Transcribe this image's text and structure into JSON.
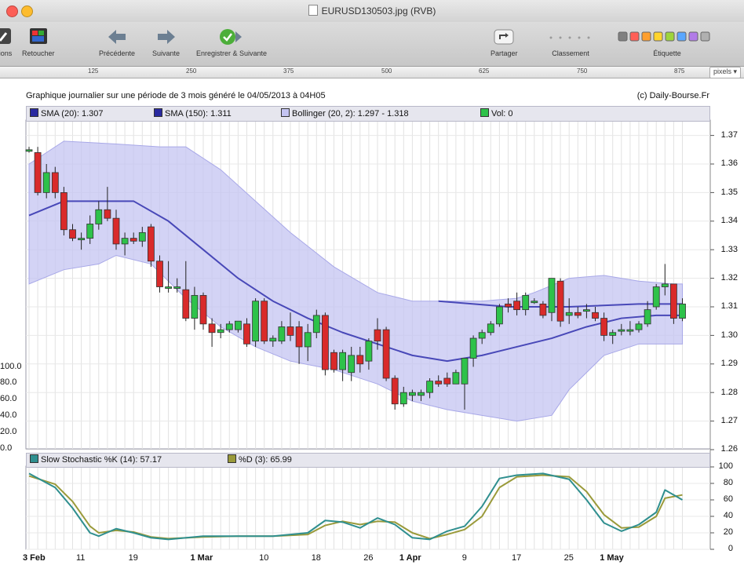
{
  "window": {
    "title": "EURUSD130503.jpg (RVB)",
    "colors": {
      "close": "#fc5f57",
      "minimize": "#fdbc2e",
      "zoom": "#28c840"
    }
  },
  "toolbar": {
    "items": [
      {
        "label": "ions",
        "icon": "adjust-icon"
      },
      {
        "label": "Retoucher",
        "icon": "retouch-icon"
      },
      {
        "label": "Précédente",
        "icon": "arrow-left-icon"
      },
      {
        "label": "Suivante",
        "icon": "arrow-right-icon"
      },
      {
        "label": "Enregistrer & Suivante",
        "icon": "save-next-icon"
      },
      {
        "label": "Partager",
        "icon": "share-icon"
      },
      {
        "label": "Classement",
        "icon": "rating-icon"
      },
      {
        "label": "Étiquette",
        "icon": "label-color-icon"
      }
    ],
    "label_colors": [
      "#808080",
      "#ff5f57",
      "#ff9f2e",
      "#ffd42e",
      "#9ed53b",
      "#5aa7ff",
      "#b27be8",
      "#b0b0b0"
    ]
  },
  "ruler": {
    "ticks": [
      "125",
      "250",
      "375",
      "500",
      "625",
      "750",
      "875"
    ],
    "unit": "pixels"
  },
  "chart": {
    "title": "Graphique journalier sur une période de 3 mois généré le 04/05/2013 à 04H05",
    "copyright": "(c) Daily-Bourse.Fr",
    "legend": {
      "sma20": "SMA (20): 1.307",
      "sma150": "SMA (150): 1.311",
      "bollinger": "Bollinger (20, 2): 1.297 - 1.318",
      "vol": "Vol: 0"
    },
    "stoch_legend": {
      "k": "Slow Stochastic %K (14): 57.17",
      "d": "%D (3): 65.99"
    },
    "colors": {
      "up": "#2ec24a",
      "down": "#d92a2a",
      "band": "#c4c4f2",
      "band_edge": "#a8a8e8",
      "sma": "#4848b8",
      "stoch_k": "#2f8f8f",
      "stoch_d": "#9a9a3a"
    }
  },
  "chart_data": {
    "type": "line",
    "price_axis": {
      "ticks": [
        "1.37",
        "1.36",
        "1.35",
        "1.34",
        "1.33",
        "1.32",
        "1.31",
        "1.30",
        "1.29",
        "1.28",
        "1.27",
        "1.26"
      ],
      "ylim": [
        1.26,
        1.37
      ]
    },
    "volume_axis": {
      "ticks": [
        "100.0",
        "80.0",
        "60.0",
        "40.0",
        "20.0",
        "0.0"
      ]
    },
    "stoch_axis": {
      "ticks": [
        "100",
        "80",
        "60",
        "40",
        "20",
        "0"
      ],
      "ylim": [
        0,
        100
      ]
    },
    "x_labels": [
      {
        "text": "3 Feb",
        "index": 0,
        "bold": true
      },
      {
        "text": "11",
        "index": 6,
        "bold": false
      },
      {
        "text": "19",
        "index": 12,
        "bold": false
      },
      {
        "text": "1 Mar",
        "index": 20,
        "bold": true
      },
      {
        "text": "10",
        "index": 27,
        "bold": false
      },
      {
        "text": "18",
        "index": 33,
        "bold": false
      },
      {
        "text": "26",
        "index": 39,
        "bold": false
      },
      {
        "text": "1 Apr",
        "index": 44,
        "bold": true
      },
      {
        "text": "9",
        "index": 50,
        "bold": false
      },
      {
        "text": "17",
        "index": 56,
        "bold": false
      },
      {
        "text": "25",
        "index": 62,
        "bold": false
      },
      {
        "text": "1 May",
        "index": 67,
        "bold": true
      }
    ],
    "candles": [
      [
        1.365,
        1.366,
        1.364,
        1.365
      ],
      [
        1.364,
        1.366,
        1.349,
        1.35
      ],
      [
        1.35,
        1.36,
        1.348,
        1.357
      ],
      [
        1.357,
        1.359,
        1.348,
        1.35
      ],
      [
        1.35,
        1.352,
        1.335,
        1.337
      ],
      [
        1.337,
        1.339,
        1.333,
        1.334
      ],
      [
        1.334,
        1.336,
        1.33,
        1.334
      ],
      [
        1.334,
        1.342,
        1.332,
        1.339
      ],
      [
        1.339,
        1.347,
        1.337,
        1.344
      ],
      [
        1.344,
        1.352,
        1.34,
        1.341
      ],
      [
        1.341,
        1.344,
        1.33,
        1.332
      ],
      [
        1.332,
        1.336,
        1.328,
        1.334
      ],
      [
        1.334,
        1.336,
        1.332,
        1.333
      ],
      [
        1.333,
        1.338,
        1.331,
        1.336
      ],
      [
        1.338,
        1.339,
        1.324,
        1.326
      ],
      [
        1.326,
        1.328,
        1.315,
        1.317
      ],
      [
        1.317,
        1.326,
        1.315,
        1.317
      ],
      [
        1.317,
        1.32,
        1.315,
        1.317
      ],
      [
        1.316,
        1.326,
        1.305,
        1.306
      ],
      [
        1.306,
        1.317,
        1.302,
        1.314
      ],
      [
        1.314,
        1.315,
        1.302,
        1.304
      ],
      [
        1.304,
        1.306,
        1.296,
        1.301
      ],
      [
        1.301,
        1.304,
        1.299,
        1.302
      ],
      [
        1.302,
        1.305,
        1.301,
        1.304
      ],
      [
        1.302,
        1.305,
        1.301,
        1.305
      ],
      [
        1.304,
        1.306,
        1.296,
        1.297
      ],
      [
        1.298,
        1.313,
        1.296,
        1.312
      ],
      [
        1.312,
        1.313,
        1.297,
        1.298
      ],
      [
        1.298,
        1.3,
        1.296,
        1.299
      ],
      [
        1.298,
        1.305,
        1.297,
        1.303
      ],
      [
        1.303,
        1.308,
        1.298,
        1.3
      ],
      [
        1.303,
        1.305,
        1.29,
        1.296
      ],
      [
        1.296,
        1.304,
        1.291,
        1.301
      ],
      [
        1.301,
        1.309,
        1.299,
        1.307
      ],
      [
        1.307,
        1.308,
        1.286,
        1.288
      ],
      [
        1.294,
        1.295,
        1.287,
        1.288
      ],
      [
        1.288,
        1.295,
        1.284,
        1.294
      ],
      [
        1.287,
        1.296,
        1.284,
        1.293
      ],
      [
        1.293,
        1.296,
        1.287,
        1.29
      ],
      [
        1.291,
        1.299,
        1.288,
        1.298
      ],
      [
        1.302,
        1.306,
        1.295,
        1.298
      ],
      [
        1.302,
        1.303,
        1.284,
        1.285
      ],
      [
        1.285,
        1.286,
        1.274,
        1.276
      ],
      [
        1.276,
        1.282,
        1.275,
        1.28
      ],
      [
        1.279,
        1.281,
        1.277,
        1.28
      ],
      [
        1.279,
        1.281,
        1.277,
        1.28
      ],
      [
        1.28,
        1.285,
        1.278,
        1.284
      ],
      [
        1.284,
        1.286,
        1.282,
        1.283
      ],
      [
        1.285,
        1.287,
        1.282,
        1.283
      ],
      [
        1.283,
        1.288,
        1.283,
        1.287
      ],
      [
        1.283,
        1.292,
        1.274,
        1.292
      ],
      [
        1.292,
        1.3,
        1.289,
        1.299
      ],
      [
        1.299,
        1.302,
        1.297,
        1.301
      ],
      [
        1.301,
        1.305,
        1.3,
        1.304
      ],
      [
        1.304,
        1.311,
        1.303,
        1.31
      ],
      [
        1.311,
        1.313,
        1.308,
        1.31
      ],
      [
        1.312,
        1.315,
        1.307,
        1.309
      ],
      [
        1.309,
        1.315,
        1.307,
        1.314
      ],
      [
        1.312,
        1.313,
        1.311,
        1.312
      ],
      [
        1.311,
        1.312,
        1.306,
        1.307
      ],
      [
        1.308,
        1.32,
        1.305,
        1.32
      ],
      [
        1.319,
        1.32,
        1.303,
        1.305
      ],
      [
        1.307,
        1.313,
        1.304,
        1.308
      ],
      [
        1.308,
        1.31,
        1.306,
        1.307
      ],
      [
        1.309,
        1.311,
        1.306,
        1.309
      ],
      [
        1.308,
        1.31,
        1.305,
        1.306
      ],
      [
        1.306,
        1.308,
        1.298,
        1.3
      ],
      [
        1.3,
        1.302,
        1.297,
        1.301
      ],
      [
        1.302,
        1.304,
        1.3,
        1.302
      ],
      [
        1.302,
        1.305,
        1.3,
        1.302
      ],
      [
        1.302,
        1.305,
        1.301,
        1.304
      ],
      [
        1.304,
        1.312,
        1.303,
        1.309
      ],
      [
        1.31,
        1.318,
        1.309,
        1.317
      ],
      [
        1.317,
        1.325,
        1.314,
        1.318
      ],
      [
        1.318,
        1.318,
        1.304,
        1.306
      ],
      [
        1.306,
        1.313,
        1.305,
        1.311
      ]
    ],
    "bollinger_upper": [
      [
        0,
        1.36
      ],
      [
        4,
        1.368
      ],
      [
        10,
        1.367
      ],
      [
        15,
        1.366
      ],
      [
        18,
        1.366
      ],
      [
        22,
        1.358
      ],
      [
        26,
        1.347
      ],
      [
        30,
        1.336
      ],
      [
        35,
        1.324
      ],
      [
        40,
        1.315
      ],
      [
        44,
        1.312
      ],
      [
        48,
        1.312
      ],
      [
        52,
        1.312
      ],
      [
        56,
        1.313
      ],
      [
        58,
        1.315
      ],
      [
        62,
        1.32
      ],
      [
        66,
        1.321
      ],
      [
        70,
        1.319
      ],
      [
        74,
        1.318
      ],
      [
        75,
        1.318
      ]
    ],
    "bollinger_lower": [
      [
        0,
        1.318
      ],
      [
        4,
        1.323
      ],
      [
        8,
        1.325
      ],
      [
        10,
        1.328
      ],
      [
        14,
        1.325
      ],
      [
        18,
        1.313
      ],
      [
        22,
        1.303
      ],
      [
        26,
        1.296
      ],
      [
        30,
        1.291
      ],
      [
        35,
        1.288
      ],
      [
        40,
        1.283
      ],
      [
        44,
        1.277
      ],
      [
        48,
        1.274
      ],
      [
        52,
        1.272
      ],
      [
        56,
        1.27
      ],
      [
        60,
        1.272
      ],
      [
        62,
        1.281
      ],
      [
        66,
        1.293
      ],
      [
        70,
        1.297
      ],
      [
        75,
        1.297
      ]
    ],
    "sma20": [
      [
        0,
        1.342
      ],
      [
        4,
        1.347
      ],
      [
        8,
        1.347
      ],
      [
        12,
        1.347
      ],
      [
        16,
        1.34
      ],
      [
        20,
        1.33
      ],
      [
        24,
        1.32
      ],
      [
        28,
        1.312
      ],
      [
        32,
        1.306
      ],
      [
        36,
        1.301
      ],
      [
        40,
        1.297
      ],
      [
        44,
        1.293
      ],
      [
        48,
        1.291
      ],
      [
        52,
        1.293
      ],
      [
        56,
        1.296
      ],
      [
        60,
        1.299
      ],
      [
        64,
        1.303
      ],
      [
        68,
        1.306
      ],
      [
        72,
        1.307
      ],
      [
        75,
        1.307
      ]
    ],
    "sma150": [
      [
        47,
        1.312
      ],
      [
        55,
        1.31
      ],
      [
        62,
        1.31
      ],
      [
        70,
        1.311
      ],
      [
        75,
        1.311
      ]
    ],
    "stoch_k": [
      [
        0,
        92
      ],
      [
        3,
        75
      ],
      [
        5,
        50
      ],
      [
        7,
        20
      ],
      [
        8,
        16
      ],
      [
        10,
        25
      ],
      [
        12,
        20
      ],
      [
        14,
        14
      ],
      [
        16,
        12
      ],
      [
        20,
        16
      ],
      [
        24,
        16
      ],
      [
        28,
        16
      ],
      [
        32,
        20
      ],
      [
        34,
        35
      ],
      [
        36,
        33
      ],
      [
        38,
        26
      ],
      [
        40,
        38
      ],
      [
        42,
        30
      ],
      [
        44,
        14
      ],
      [
        46,
        12
      ],
      [
        48,
        22
      ],
      [
        50,
        28
      ],
      [
        52,
        52
      ],
      [
        54,
        86
      ],
      [
        56,
        90
      ],
      [
        59,
        92
      ],
      [
        62,
        85
      ],
      [
        64,
        60
      ],
      [
        66,
        32
      ],
      [
        68,
        22
      ],
      [
        70,
        30
      ],
      [
        72,
        45
      ],
      [
        73,
        72
      ],
      [
        75,
        60
      ]
    ],
    "stoch_d": [
      [
        0,
        89
      ],
      [
        3,
        79
      ],
      [
        5,
        58
      ],
      [
        7,
        28
      ],
      [
        8,
        20
      ],
      [
        10,
        23
      ],
      [
        12,
        21
      ],
      [
        14,
        15
      ],
      [
        16,
        13
      ],
      [
        20,
        15
      ],
      [
        24,
        16
      ],
      [
        28,
        16
      ],
      [
        32,
        18
      ],
      [
        34,
        29
      ],
      [
        36,
        34
      ],
      [
        38,
        30
      ],
      [
        40,
        34
      ],
      [
        42,
        33
      ],
      [
        44,
        20
      ],
      [
        46,
        13
      ],
      [
        48,
        18
      ],
      [
        50,
        24
      ],
      [
        52,
        40
      ],
      [
        54,
        75
      ],
      [
        56,
        88
      ],
      [
        59,
        90
      ],
      [
        62,
        88
      ],
      [
        64,
        70
      ],
      [
        66,
        42
      ],
      [
        68,
        26
      ],
      [
        70,
        27
      ],
      [
        72,
        40
      ],
      [
        73,
        62
      ],
      [
        75,
        66
      ]
    ]
  }
}
